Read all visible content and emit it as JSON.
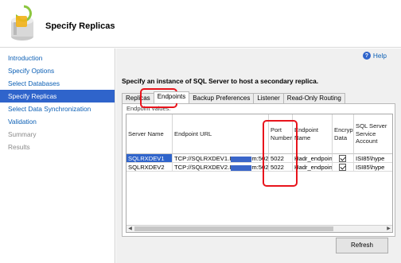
{
  "window": {
    "title": "Specify Replicas"
  },
  "sidebar": {
    "items": [
      {
        "label": "Introduction",
        "state": "link"
      },
      {
        "label": "Specify Options",
        "state": "link"
      },
      {
        "label": "Select Databases",
        "state": "link"
      },
      {
        "label": "Specify Replicas",
        "state": "selected"
      },
      {
        "label": "Select Data Synchronization",
        "state": "link"
      },
      {
        "label": "Validation",
        "state": "link"
      },
      {
        "label": "Summary",
        "state": "disabled"
      },
      {
        "label": "Results",
        "state": "disabled"
      }
    ]
  },
  "help": {
    "label": "Help",
    "icon": "help-circle-icon"
  },
  "main": {
    "instruction": "Specify an instance of SQL Server to host a secondary replica.",
    "tabs": [
      "Replicas",
      "Endpoints",
      "Backup Preferences",
      "Listener",
      "Read-Only Routing"
    ],
    "active_tab": "Endpoints",
    "section_label": "Endpoint values:",
    "columns": [
      "Server Name",
      "Endpoint URL",
      "Port Number",
      "Endpoint Name",
      "Encrypt Data",
      "SQL Server Service Account"
    ],
    "rows": [
      {
        "server": "SQLRXDEV1",
        "url_start": "TCP://SQLRXDEV1.I",
        "url_end": "m:5022",
        "port": "5022",
        "endpoint": "Hadr_endpoint",
        "encrypt": true,
        "account": "ISI85\\hype"
      },
      {
        "server": "SQLRXDEV2",
        "url_start": "TCP://SQLRXDEV2.I",
        "url_end": "m:5022",
        "port": "5022",
        "endpoint": "Hadr_endpoint",
        "encrypt": true,
        "account": "ISI85\\hype"
      }
    ],
    "refresh_label": "Refresh"
  },
  "colors": {
    "selection": "#2f64cb",
    "link": "#0b5fb5",
    "annotation": "#e8141c"
  }
}
